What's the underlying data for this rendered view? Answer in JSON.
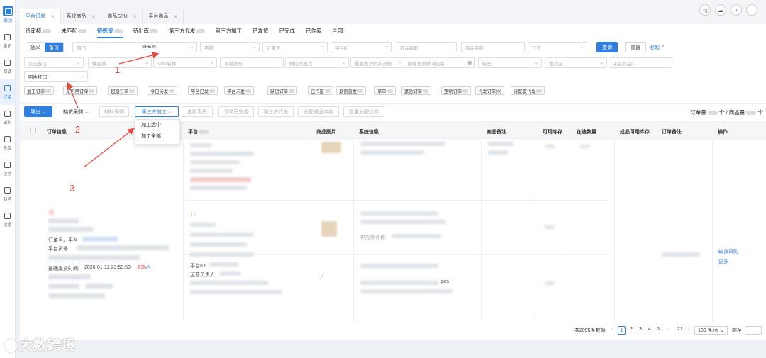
{
  "sidebar": {
    "logo_text": "联动",
    "items": [
      {
        "label": "全员",
        "icon": "home-icon"
      },
      {
        "label": "商品",
        "icon": "bag-icon"
      },
      {
        "label": "订单",
        "icon": "document-icon"
      },
      {
        "label": "采购",
        "icon": "cart-icon"
      },
      {
        "label": "仓库",
        "icon": "warehouse-icon"
      },
      {
        "label": "运营",
        "icon": "chart-icon"
      },
      {
        "label": "财务",
        "icon": "finance-icon"
      },
      {
        "label": "设置",
        "icon": "gear-icon"
      }
    ]
  },
  "tabs": [
    {
      "label": "平台订单",
      "active": true
    },
    {
      "label": "系统商品",
      "active": false
    },
    {
      "label": "商品SPU",
      "active": false
    },
    {
      "label": "平台商品",
      "active": false
    }
  ],
  "status_tabs": [
    {
      "label": "待审核"
    },
    {
      "label": "未匹配"
    },
    {
      "label": "待拣货",
      "active": true
    },
    {
      "label": "待出库"
    },
    {
      "label": "第三方代发"
    },
    {
      "label": "第三方加工"
    },
    {
      "label": "已发货"
    },
    {
      "label": "已完成"
    },
    {
      "label": "已作废"
    },
    {
      "label": "全部"
    }
  ],
  "filters": {
    "mode_urgent": "急采",
    "mode_stock": "备货",
    "dept": "部门",
    "platform_value": "SHEIN",
    "store": "店铺",
    "order_no": "订单号",
    "platform_id": "平台ID",
    "goods_code": "商品编码",
    "goods_name": "商品名称",
    "craft": "工艺",
    "query_btn": "查询",
    "reset_btn": "重置",
    "collapse_link": "收起",
    "remark": "有无备注",
    "supplier": "供应商",
    "spu": "SPU名称",
    "platform_order": "平台货号",
    "prepick": "预拣货批次",
    "latest_ship_start": "最晚发货时间开始",
    "latest_ship_end": "最晚发货时间结束",
    "tag": "标签",
    "stock_area": "备货区",
    "platform_goods_id": "平台商品ID",
    "photo_print": "照片打印"
  },
  "quick_tags": [
    "加工订单",
    "无可用订单",
    "超期订单",
    "今日待发",
    "平台已发",
    "平台未发",
    "缺货订单",
    "已作废",
    "退货重发",
    "草单",
    "紧急订单",
    "定制订单",
    "代发订单(0)",
    "待配置代发"
  ],
  "toolbar": {
    "export": "导出",
    "restock_purchase": "缺货采购",
    "material_purchase": "材料采购",
    "third_party_processing": "第三方加工",
    "virtual_ship": "虚拟发货",
    "order_done": "订单已完成",
    "third_party_ship": "第三方代发",
    "assign_stock": "分配成品库存",
    "batch_assign_warehouse": "批量分配仓库",
    "order_count_label": "订单量",
    "order_count_sep": "个 / 商品量",
    "unit": "个"
  },
  "dropdown": {
    "items": [
      "加工选中",
      "加工全部"
    ]
  },
  "table": {
    "headers": [
      "订单信息",
      "平台",
      "商品图片",
      "系统信息",
      "商品备注",
      "可用库存",
      "在途数量",
      "成品可用库存",
      "订单备注",
      "操作"
    ],
    "order": {
      "order_no_label": "订单号、平台",
      "platform_order_label": "平台货号",
      "latest_ship_label": "最晚发货时间:",
      "latest_ship_value": "2026-01-12 23:59:59",
      "overdue": "-63h",
      "platform_id_label": "平台ID:",
      "operator_label": "运营负责人:",
      "pcs_text": "pcs",
      "supplier_label": "供应商名称:"
    },
    "actions": [
      "缺货采购",
      "更多"
    ]
  },
  "pagination": {
    "total": "共2095条数据",
    "pages": [
      "1",
      "2",
      "3",
      "4",
      "5",
      "21"
    ],
    "ellipsis": "···",
    "page_size": "100 条/页",
    "jump_label": "跳至"
  },
  "annotations": [
    "1",
    "2",
    "3"
  ],
  "watermark": "大数跨境"
}
